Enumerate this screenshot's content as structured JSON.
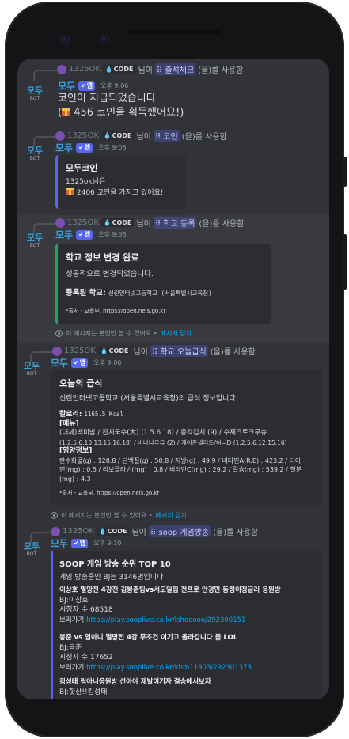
{
  "bot": {
    "avatar_text": "모두",
    "avatar_sub": "BOT",
    "name": "모두",
    "badge": "앱",
    "badge_icon": "check-icon"
  },
  "user": {
    "name": "1325OK",
    "badge": "CODE"
  },
  "messages": [
    {
      "ref": {
        "mid": "님이",
        "command": "출석체크",
        "suffix": "(을)를 사용함"
      },
      "time": "오후 9:06",
      "lines": [
        "코인이 지급되었습니다",
        "456 코인을 획득했어요!)"
      ],
      "line2_prefix": "("
    },
    {
      "ref": {
        "mid": "님이",
        "command": "코인",
        "suffix": "(을)를 사용함"
      },
      "time": "오후 9:06",
      "embed": {
        "title": "모두코인",
        "line1": "1325ok님은",
        "line2": "2406 코인을 가지고 있어요!"
      }
    },
    {
      "ref": {
        "mid": "님이",
        "command": "학교 등록",
        "suffix": "(을)를 사용함"
      },
      "time": "오후 9:06",
      "embed": {
        "title": "학교 정보 변경 완료",
        "desc": "성공적으로 변경되었습니다.",
        "field_label": "등록된 학교:",
        "field_value": "선린인터넷고등학교 (서울특별시교육청)",
        "source": "*출처 - 교육부, https://open.neis.go.kr"
      },
      "ephemeral": {
        "text": "이 메시지는 본인만 볼 수 있어요 •",
        "dismiss": "메시지 닫기"
      }
    },
    {
      "ref": {
        "mid": "님이",
        "command": "학교 오늘급식",
        "suffix": "(을)를 사용함"
      },
      "time": "오후 9:06",
      "embed": {
        "title": "오늘의 급식",
        "desc": "선린인터넷고등학교 (서울특별시교육청)의 급식 정보입니다.",
        "cal_label": "칼로리:",
        "cal_value": "1165.5 Kcal",
        "menu_label": "[메뉴]",
        "menu_lines": [
          "(대체)백미밥 / 잔치국수(大) (1.5.6.18) / 총각김치 (9) / 수제크로크무슈",
          "(1.2.5.6.10.13.15.16.18) / 바나나우유 (2) / 케이준샐러드/허니D (1.2.5.6.12.15.16)"
        ],
        "nutri_label": "[영양정보]",
        "nutri_lines": [
          "탄수화물(g) : 128.8 / 단백질(g) : 50.8 / 지방(g) : 49.9 / 비타민A(R.E) : 423.2 / 티아",
          "민(mg) : 0.5 / 리보플라빈(mg) : 0.8 / 비타민C(mg) : 29.2 / 칼슘(mg) : 539.2 / 철분",
          "(mg) : 4.3"
        ],
        "source": "*출처 - 교육부, https://open.neis.go.kr"
      },
      "ephemeral": {
        "text": "이 메시지는 본인만 볼 수 있어요 •",
        "dismiss": "메시지 닫기"
      }
    },
    {
      "ref": {
        "mid": "님이",
        "command": "soop 게임방송",
        "suffix": "(을)를 사용함"
      },
      "time": "오후 9:10",
      "embed": {
        "title": "SOOP 게임 방송 순위 TOP 10",
        "desc": "게임 방송중인 BJ는 3146명입니다",
        "items": [
          {
            "title": "이상호 멸망전 4강전 김봉준팀vs서도일팀 전프로 안경민 동랭이정글러 응원방",
            "bj": "BJ:이상호",
            "viewers": "시청자 수:68518",
            "link_label": "보러가기:",
            "link": "https://play.sooplive.co.kr/lshooooo/292300151"
          },
          {
            "title": "봉준 vs 임아니 멸망전 4강 무조건 이기고 올라갑니다 롤 LOL",
            "bj": "BJ:봉준",
            "viewers": "시청자 수:17652",
            "link_label": "보러가기:",
            "link": "https://play.sooplive.co.kr/khm11903/292301373"
          },
          {
            "title": "킹성태 림아니응원방 선아야 제발이기자 결승에서보자",
            "bj": "BJ:핫산!!킹성태"
          }
        ]
      }
    }
  ]
}
